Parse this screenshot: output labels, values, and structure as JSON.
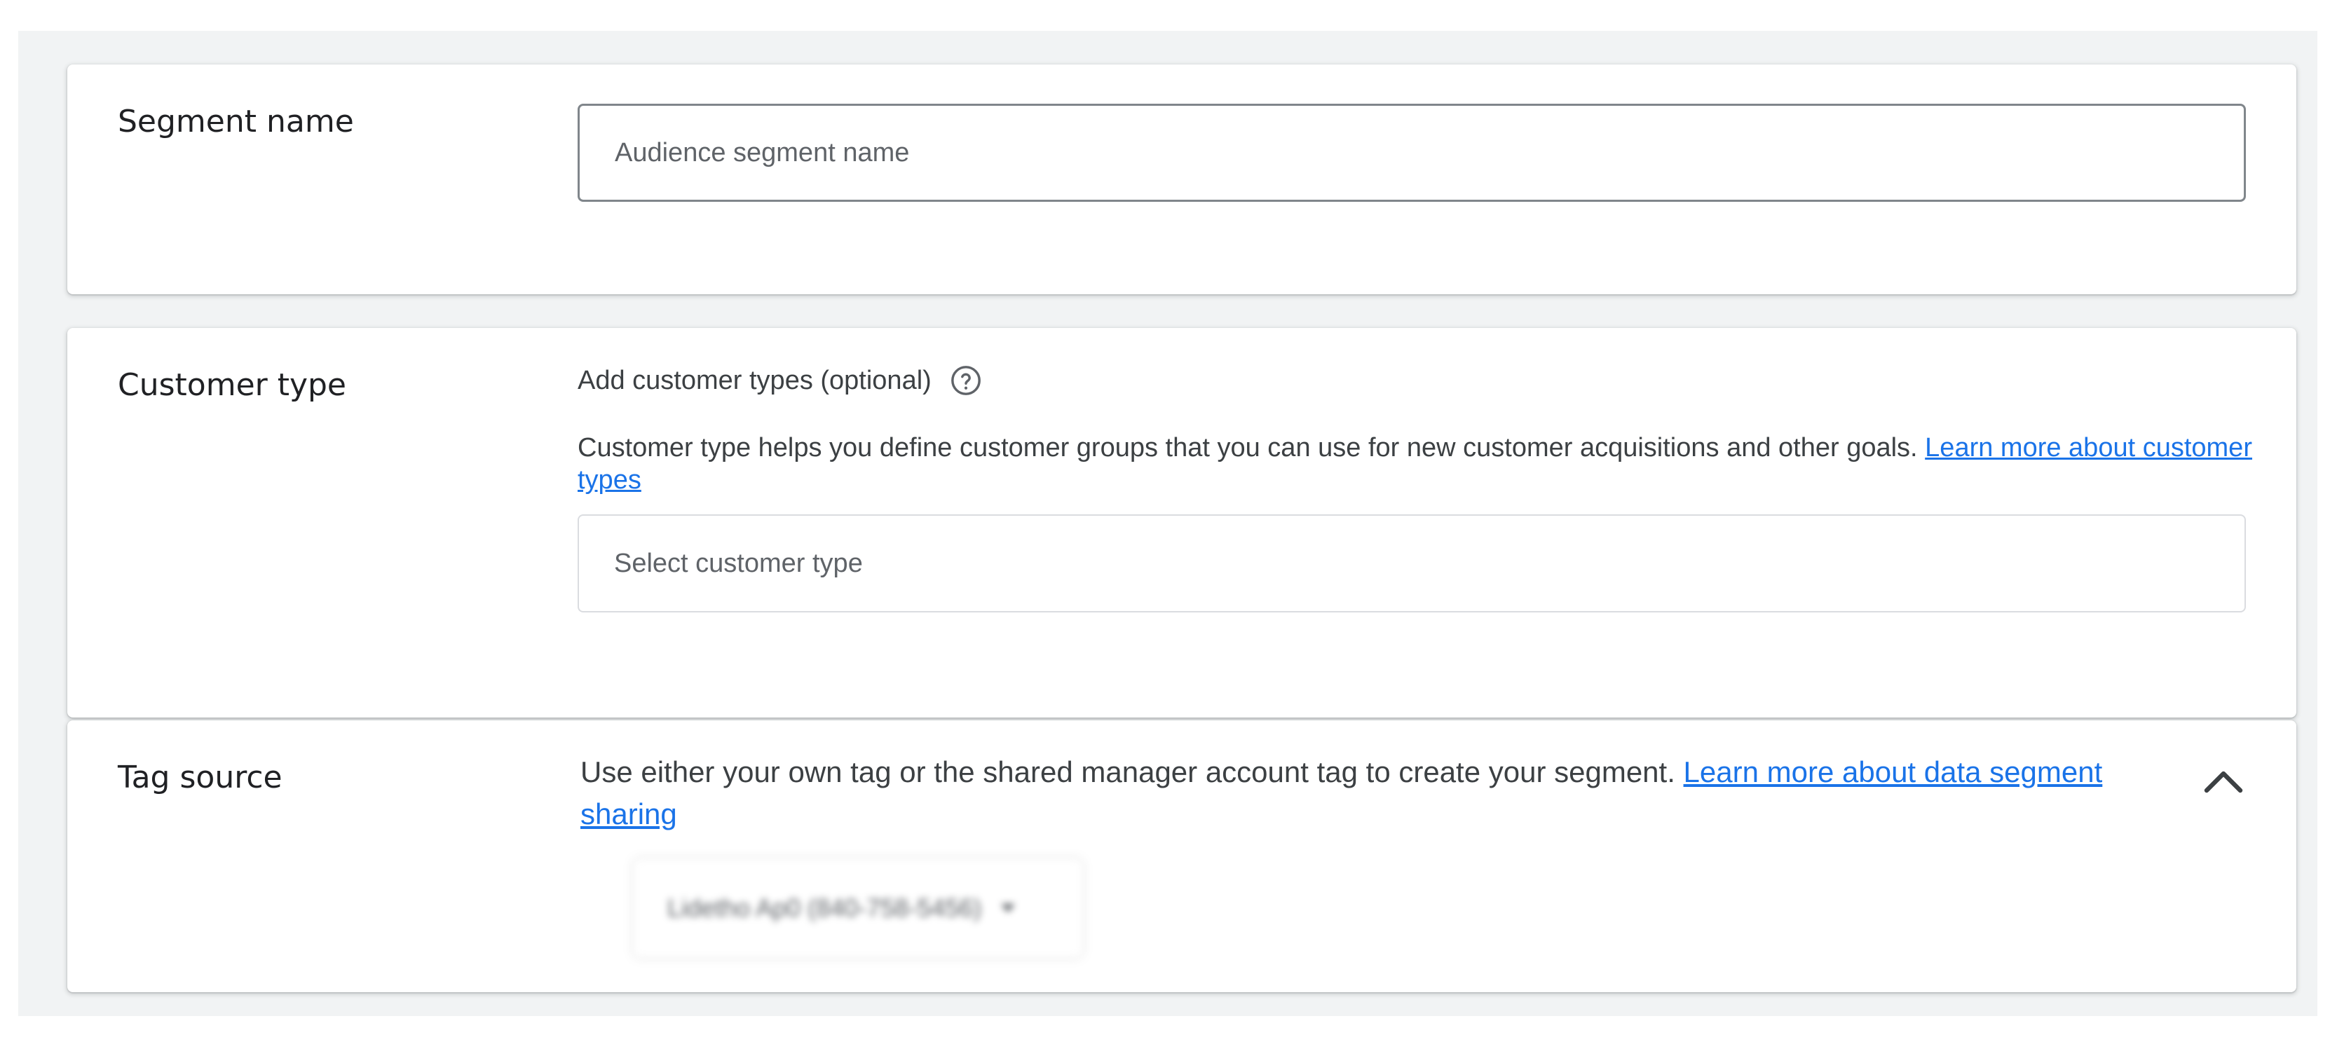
{
  "segment_name": {
    "title": "Segment name",
    "input_placeholder": "Audience segment name",
    "input_value": ""
  },
  "customer_type": {
    "title": "Customer type",
    "subtitle": "Add customer types (optional)",
    "help_icon": "help-circle-icon",
    "description": "Customer type helps you define customer groups that you can use for new customer acquisitions and other goals.",
    "learn_more_link": "Learn more about customer types",
    "select_placeholder": "Select customer type"
  },
  "tag_source": {
    "title": "Tag source",
    "description": "Use either your own tag or the shared manager account tag to create your segment.",
    "learn_more_link": "Learn more about data segment sharing",
    "collapse_icon": "chevron-up-icon",
    "selected_tag": "Lidetho Ap0 (840-758-5456)",
    "selected_tag_blurred": true
  },
  "colors": {
    "link": "#1a73e8",
    "background": "#f1f3f4",
    "card": "#ffffff"
  }
}
